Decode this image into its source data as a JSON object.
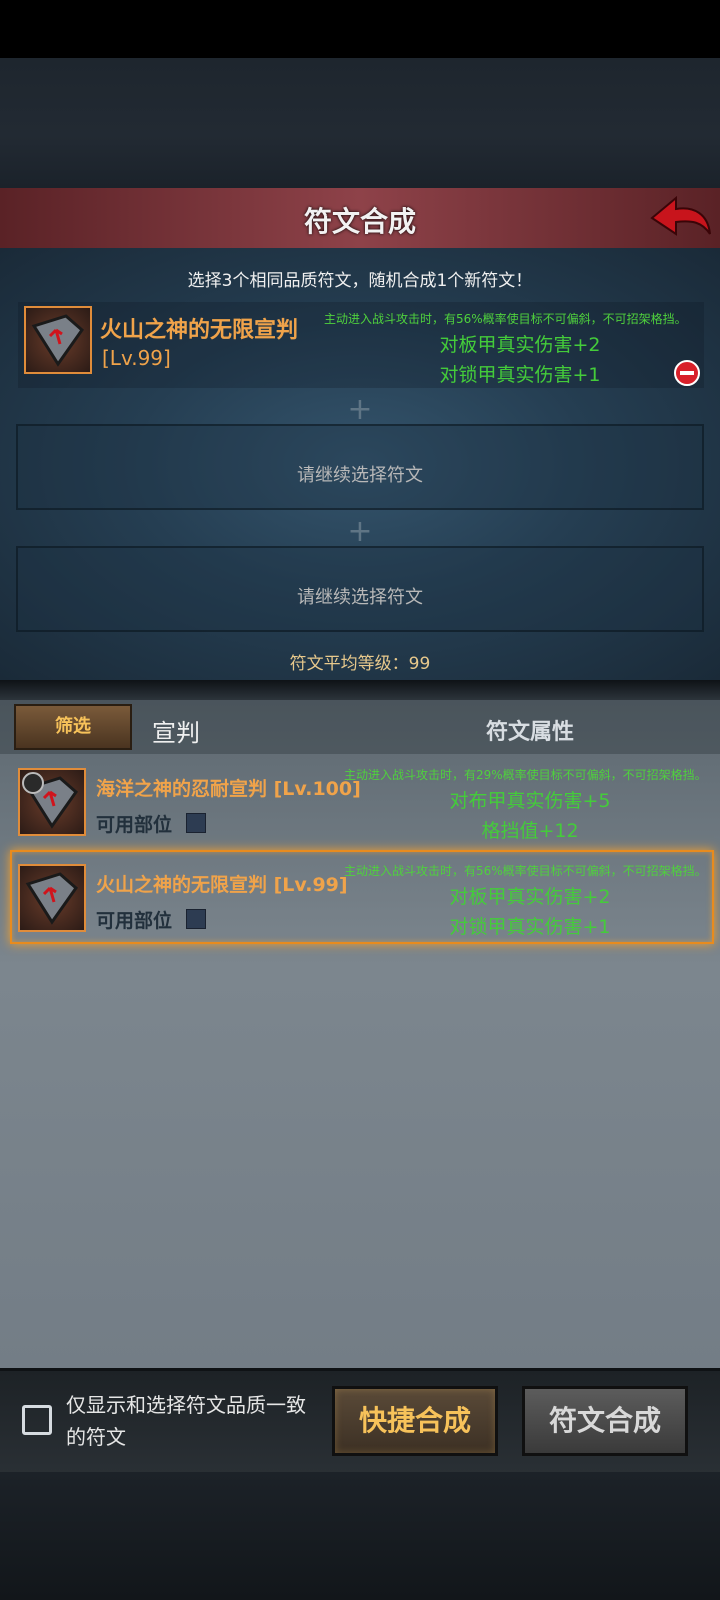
{
  "title": "符文合成",
  "hint": "选择3个相同品质符文，随机合成1个新符文！",
  "selected_slot": {
    "name": "火山之神的无限宣判",
    "level": "[Lv.99]",
    "effect": "主动进入战斗攻击时，有56%概率使目标不可偏斜，不可招架格挡。",
    "stats": [
      "对板甲真实伤害+2",
      "对锁甲真实伤害+1"
    ]
  },
  "empty_slot_text": "请继续选择符文",
  "plus": "+",
  "avg_level": "符文平均等级：99",
  "filter_label": "筛选",
  "category": "宣判",
  "attr_header": "符文属性",
  "list": [
    {
      "name": "海洋之神的忍耐宣判 [Lv.100]",
      "slot_label": "可用部位",
      "effect": "主动进入战斗攻击时，有29%概率使目标不可偏斜，不可招架格挡。",
      "stats": [
        "对布甲真实伤害+5",
        "格挡值+12"
      ],
      "locked": true
    },
    {
      "name": "火山之神的无限宣判 [Lv.99]",
      "slot_label": "可用部位",
      "effect": "主动进入战斗攻击时，有56%概率使目标不可偏斜，不可招架格挡。",
      "stats": [
        "对板甲真实伤害+2",
        "对锁甲真实伤害+1"
      ],
      "selected": true
    }
  ],
  "checkbox_label": "仅显示和选择符文品质一致的符文",
  "quick_button": "快捷合成",
  "synth_button": "符文合成"
}
